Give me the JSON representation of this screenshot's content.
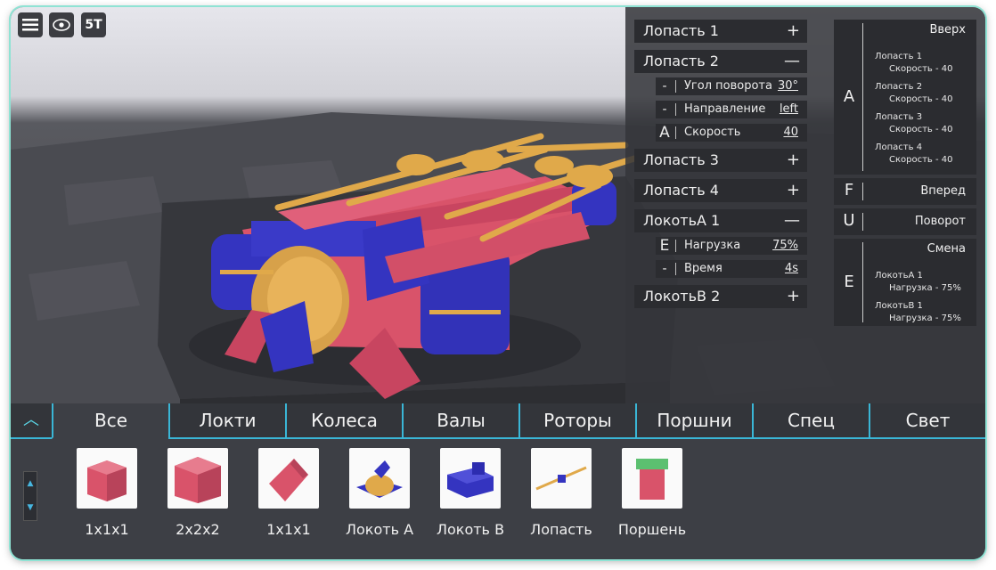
{
  "toolbar": {
    "menu_icon": "hamburger-icon",
    "view_icon": "eye-icon",
    "logo_text": "5T"
  },
  "parts": [
    {
      "label": "Лопасть 1",
      "toggle": "+"
    },
    {
      "label": "Лопасть 2",
      "toggle": "—"
    },
    {
      "label": "Лопасть 3",
      "toggle": "+"
    },
    {
      "label": "Лопасть 4",
      "toggle": "+"
    },
    {
      "label": "ЛокотьА 1",
      "toggle": "—"
    },
    {
      "label": "ЛокотьB 2",
      "toggle": "+"
    }
  ],
  "blade2_props": [
    {
      "key": "-",
      "label": "Угол поворота",
      "value": "30°"
    },
    {
      "key": "-",
      "label": "Направление",
      "value": "left"
    },
    {
      "key": "A",
      "label": "Скорость",
      "value": "40"
    }
  ],
  "elbowA_props": [
    {
      "key": "E",
      "label": "Нагрузка",
      "value": "75%"
    },
    {
      "key": "-",
      "label": "Время",
      "value": "4s"
    }
  ],
  "commands": {
    "up": {
      "key": "A",
      "title": "Вверх",
      "entries": [
        {
          "name": "Лопасть 1",
          "detail": "Скорость - 40"
        },
        {
          "name": "Лопасть 2",
          "detail": "Скорость - 40"
        },
        {
          "name": "Лопасть 3",
          "detail": "Скорость - 40"
        },
        {
          "name": "Лопасть 4",
          "detail": "Скорость - 40"
        }
      ]
    },
    "forward": {
      "key": "F",
      "title": "Вперед"
    },
    "turn": {
      "key": "U",
      "title": "Поворот"
    },
    "change": {
      "key": "E",
      "title": "Смена",
      "entries": [
        {
          "name": "ЛокотьА 1",
          "detail": "Нагрузка - 75%"
        },
        {
          "name": "ЛокотьB 1",
          "detail": "Нагрузка - 75%"
        }
      ]
    }
  },
  "tabs": [
    "Все",
    "Локти",
    "Колеса",
    "Валы",
    "Роторы",
    "Поршни",
    "Спец",
    "Свет"
  ],
  "active_tab": "Все",
  "library": [
    {
      "label": "1x1x1"
    },
    {
      "label": "2x2x2"
    },
    {
      "label": "1x1x1"
    },
    {
      "label": "Локоть А"
    },
    {
      "label": "Локоть B"
    },
    {
      "label": "Лопасть"
    },
    {
      "label": "Поршень"
    }
  ],
  "colors": {
    "accent": "#3ab6d6",
    "body_red": "#d9536a",
    "body_blue": "#3434c0",
    "blade_gold": "#e0a94a",
    "panel": "#2b2c30"
  }
}
